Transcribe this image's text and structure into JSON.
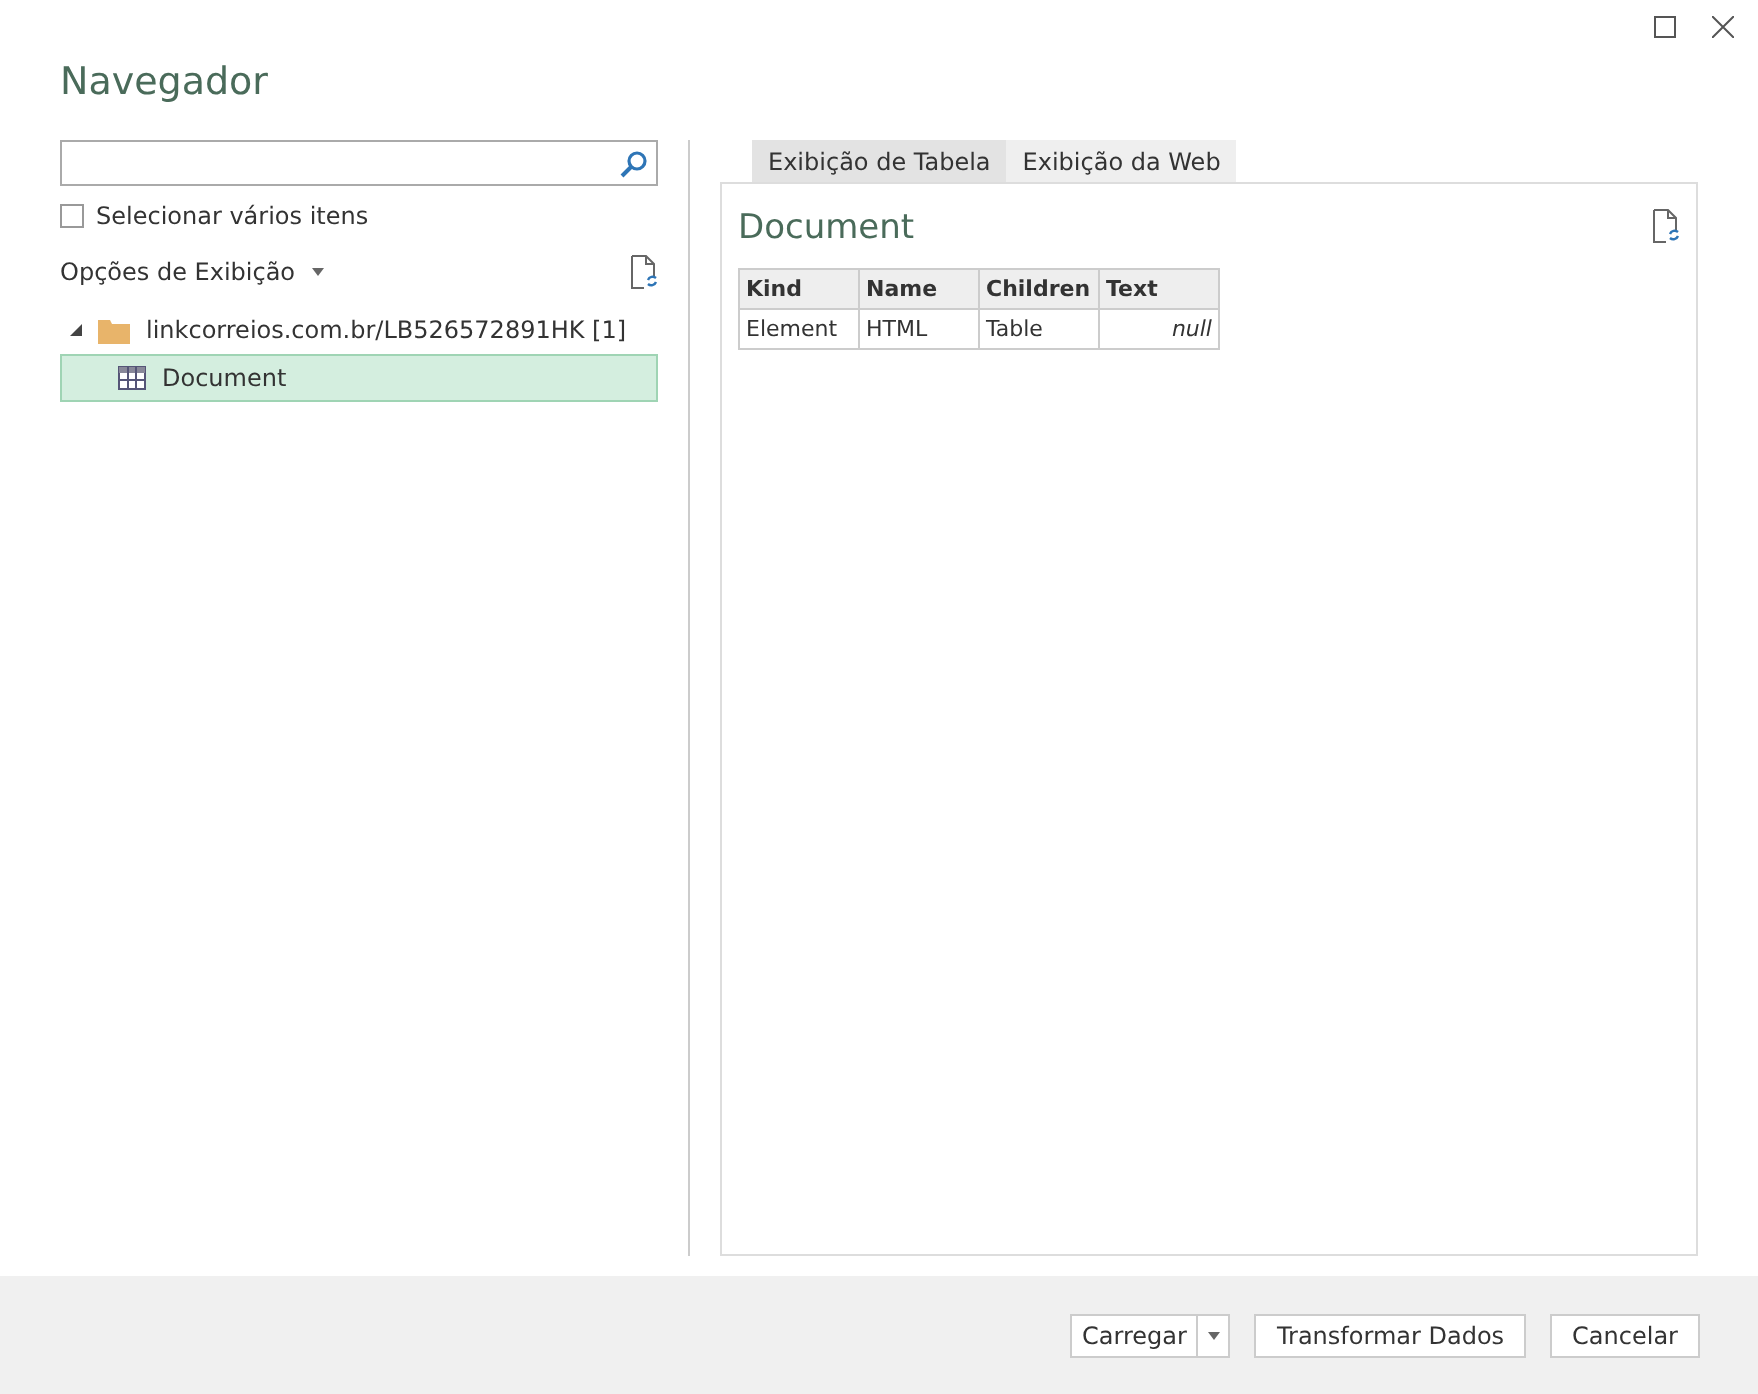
{
  "window": {
    "title": "Navegador"
  },
  "select_multiple": {
    "label": "Selecionar vários itens",
    "checked": false
  },
  "display_options": {
    "label": "Opções de Exibição"
  },
  "tree": [
    {
      "label": "linkcorreios.com.br/LB526572891HK [1]",
      "expanded": true,
      "selected": false,
      "children": [
        {
          "label": "Document",
          "selected": true
        }
      ]
    }
  ],
  "tabs": [
    {
      "label": "Exibição de Tabela",
      "selected": true
    },
    {
      "label": "Exibição da Web",
      "selected": false
    }
  ],
  "preview": {
    "title": "Document",
    "columns": [
      "Kind",
      "Name",
      "Children",
      "Text"
    ],
    "rows": [
      [
        {
          "text": "Element",
          "italic": false
        },
        {
          "text": "HTML",
          "italic": false
        },
        {
          "text": "Table",
          "italic": false
        },
        {
          "text": "null",
          "italic": true
        }
      ]
    ]
  },
  "buttons": [
    {
      "label": "Carregar",
      "kind": "split"
    },
    {
      "label": "Transformar Dados",
      "kind": "plain"
    },
    {
      "label": "Cancelar",
      "kind": "plain"
    }
  ]
}
